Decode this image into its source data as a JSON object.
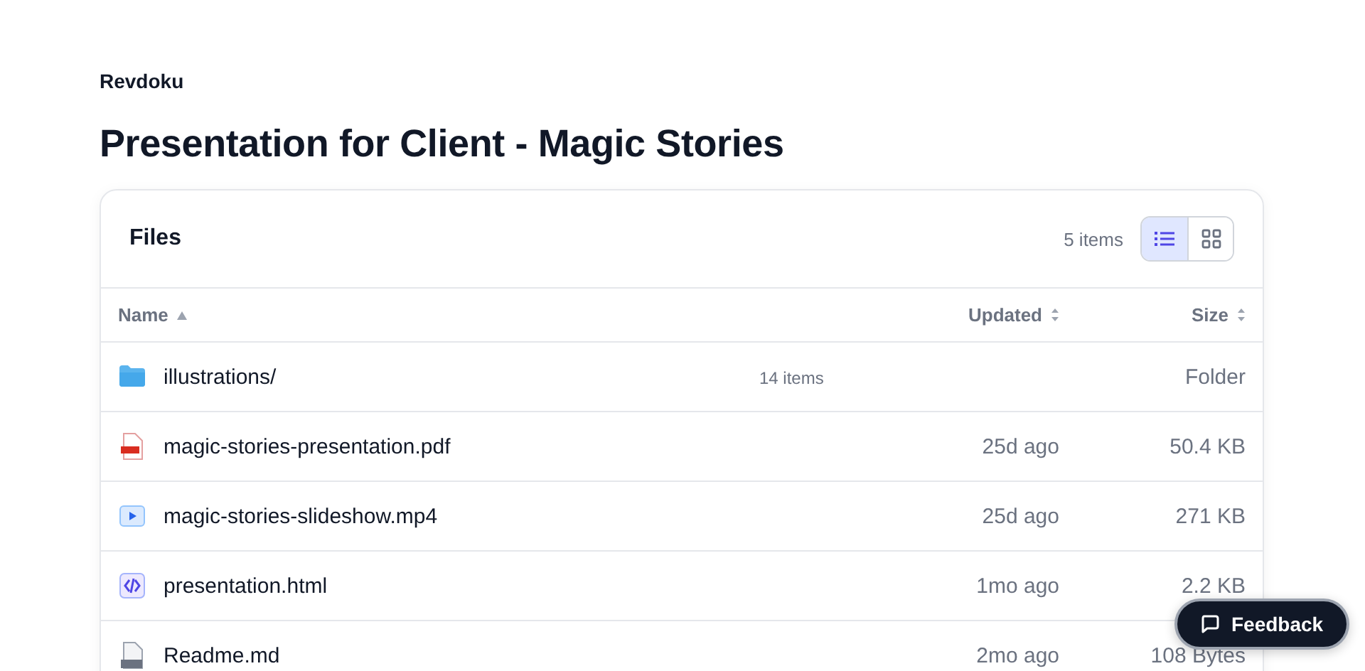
{
  "brand": "Revdoku",
  "title": "Presentation for Client - Magic Stories",
  "panel": {
    "title": "Files",
    "count": "5 items",
    "views": [
      {
        "kind": "list",
        "selected": true
      },
      {
        "kind": "grid",
        "selected": false
      }
    ]
  },
  "table": {
    "columns": [
      {
        "label": "Name",
        "sorted": true
      },
      {
        "label": "Updated",
        "sorted": false
      },
      {
        "label": "Size",
        "sorted": false
      }
    ],
    "rows": [
      {
        "kind": "folder",
        "name": "illustrations/",
        "count": "14 items",
        "size": "Folder"
      },
      {
        "kind": "pdf",
        "name": "magic-stories-presentation.pdf",
        "updated": "25d ago",
        "size": "50.4 KB"
      },
      {
        "kind": "video",
        "name": "magic-stories-slideshow.mp4",
        "updated": "25d ago",
        "size": "271 KB"
      },
      {
        "kind": "code",
        "name": "presentation.html",
        "updated": "1mo ago",
        "size": "2.2 KB"
      },
      {
        "kind": "text",
        "name": "Readme.md",
        "updated": "2mo ago",
        "size": "108 Bytes"
      }
    ]
  },
  "feedback": {
    "label": "Feedback"
  }
}
